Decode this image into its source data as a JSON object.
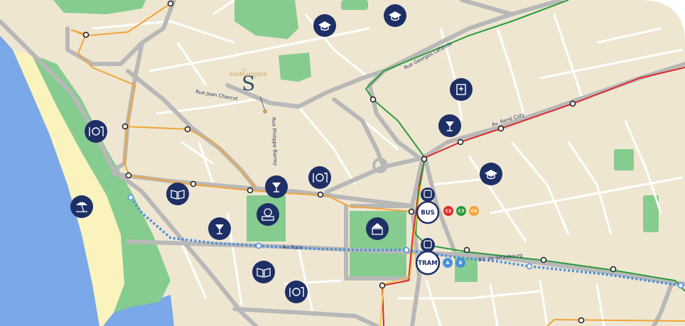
{
  "map": {
    "colors": {
      "background": "#efe6d2",
      "sea": "#7aa8e8",
      "beach": "#fbf3bd",
      "park": "#86cc8f",
      "road": "#b8b8b8",
      "minor_road": "#ffffff",
      "bus_line_orange": "#f0a53a",
      "bus_line_red": "#dd2a2a",
      "bus_line_green": "#2a9a3a",
      "tram_line": "#4a90d9",
      "poi_fill": "#1e2f66",
      "logo_gold": "#c9a25c",
      "logo_teal": "#2e5164"
    },
    "logo": {
      "prefix": "le",
      "name": "southampton",
      "mark": "S"
    },
    "streets": {
      "rue_jean_charcot": "Rue Jean Charcot",
      "rue_philippe_barrey": "Rue Philippe Barrey",
      "rue_georges_lafaurie": "Rue Georges Lafaurie",
      "av_rene_coty": "Av. René Coty",
      "av_foch": "Av. Foch",
      "bd_de_strasbourg": "Bd. de Strasbourg"
    },
    "transit": {
      "bus": {
        "label": "BUS",
        "lines": [
          "C2",
          "C3",
          "C4"
        ],
        "line_colors": [
          "#dd2a2a",
          "#2a9a3a",
          "#f0a53a"
        ]
      },
      "tram": {
        "label": "TRAM",
        "lines": [
          "A",
          "B"
        ],
        "line_colors": [
          "#4a90d9",
          "#4a90d9"
        ]
      }
    },
    "poi_icons": [
      "school-icon",
      "school-icon",
      "school-icon",
      "hospital-icon",
      "restaurant-icon",
      "restaurant-icon",
      "restaurant-icon",
      "pharmacy-icon",
      "pharmacy-icon",
      "pharmacy-icon",
      "library-icon",
      "library-icon",
      "museum-icon",
      "town-hall-icon",
      "beach-icon"
    ]
  }
}
